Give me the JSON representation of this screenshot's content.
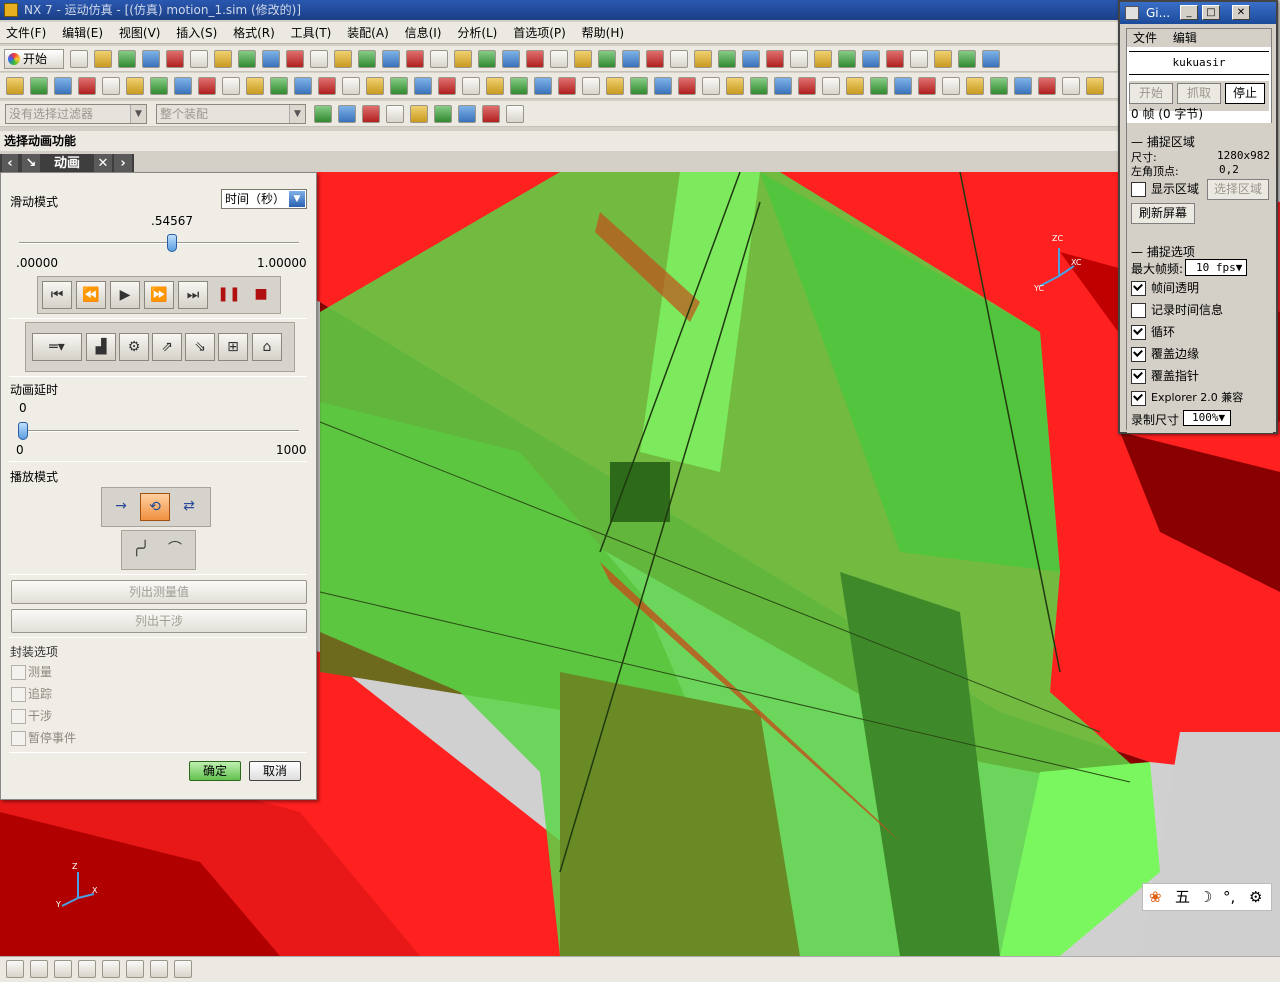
{
  "window": {
    "title": "NX 7 - 运动仿真 - [(仿真) motion_1.sim (修改的)]"
  },
  "menubar": [
    "文件(F)",
    "编辑(E)",
    "视图(V)",
    "插入(S)",
    "格式(R)",
    "工具(T)",
    "装配(A)",
    "信息(I)",
    "分析(L)",
    "首选项(P)",
    "帮助(H)"
  ],
  "toolbar": {
    "start_label": "开始",
    "filter_combo": "没有选择过滤器",
    "assembly_combo": "整个装配"
  },
  "status_line": "选择动画功能",
  "panel": {
    "tab_title": "动画",
    "slider_mode_label": "滑动模式",
    "slider_mode_value": "时间（秒）",
    "slider_value": ".54567",
    "slider_fraction": 0.54567,
    "slider_min": ".00000",
    "slider_max": "1.00000",
    "delay_label": "动画延时",
    "delay_value": "0",
    "delay_min": "0",
    "delay_max": "1000",
    "play_mode_label": "播放模式",
    "list_measure_button": "列出测量值",
    "list_interference_button": "列出干涉",
    "envelope_label": "封装选项",
    "options": [
      "测量",
      "追踪",
      "干涉",
      "暂停事件"
    ],
    "ok_button": "确定",
    "cancel_button": "取消"
  },
  "gif_window": {
    "title": "Gi...",
    "menu": [
      "文件",
      "编辑"
    ],
    "user": "kukuasir",
    "start_button": "开始",
    "capture_button": "抓取",
    "stop_button": "停止",
    "frames_text": "0 帧 (0 字节)",
    "capture_area_label": "捕捉区域",
    "size_label": "尺寸:",
    "size_value": "1280x982",
    "corner_label": "左角顶点:",
    "corner_value": "0,2",
    "show_area_label": "显示区域",
    "select_area_button": "选择区域",
    "refresh_button": "刷新屏幕",
    "capture_options_label": "捕捉选项",
    "max_fps_label": "最大帧频:",
    "max_fps_value": "10 fps",
    "checks": [
      {
        "label": "帧间透明",
        "checked": true
      },
      {
        "label": "记录时间信息",
        "checked": false
      },
      {
        "label": "循环",
        "checked": true
      },
      {
        "label": "覆盖边缘",
        "checked": true
      },
      {
        "label": "覆盖指针",
        "checked": true
      },
      {
        "label": "Explorer 2.0 兼容",
        "checked": true
      }
    ],
    "record_size_label": "录制尺寸",
    "record_size_value": "100%"
  },
  "triad_top": {
    "z": "ZC",
    "x": "XC",
    "y": "YC"
  },
  "triad_bottom": {
    "z": "Z",
    "x": "X",
    "y": "Y"
  },
  "ime_bar": {
    "char": "五"
  },
  "colors": {
    "red": "#ff2020",
    "dark_red": "#8a0000",
    "green": "#5bd646",
    "olive": "#6d6a1e"
  }
}
